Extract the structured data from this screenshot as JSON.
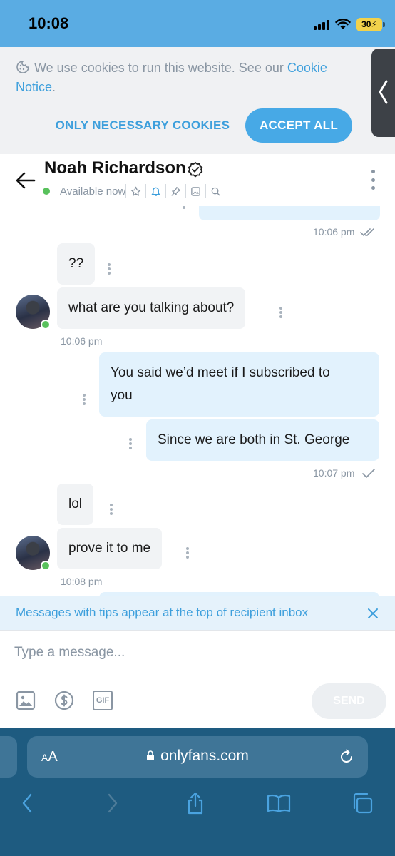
{
  "status_bar": {
    "time": "10:08",
    "battery": "30"
  },
  "cookie_banner": {
    "text": "We use cookies to run this website. See our ",
    "link": "Cookie Notice",
    "period": ".",
    "only_necessary": "ONLY NECESSARY COOKIES",
    "accept_all": "ACCEPT ALL"
  },
  "chat_header": {
    "name": "Noah Richardson",
    "status": "Available now"
  },
  "messages": {
    "first_time": "10:06 pm",
    "m1": "??",
    "m2": "what are you talking about?",
    "time2": "10:06 pm",
    "m3_line1": "You said we’d meet if I subscribed to",
    "m3_line2": "you",
    "m4": "Since we are both in St. George",
    "time3": "10:07 pm",
    "m5": "lol",
    "m6": "prove it to me",
    "time4": "10:08 pm"
  },
  "tips_notice": {
    "text": "Messages with tips appear at the top of recipient inbox"
  },
  "composer": {
    "placeholder": "Type a message...",
    "send": "SEND",
    "gif": "GIF"
  },
  "browser": {
    "aa_small": "A",
    "aa_large": "A",
    "url": "onlyfans.com"
  },
  "icons": {
    "cookie": "cookie-icon",
    "back": "back-arrow-icon",
    "verified": "verified-badge-icon",
    "star": "star-icon",
    "bell": "bell-icon",
    "pin": "pin-icon",
    "image": "image-icon",
    "search": "search-icon",
    "more": "more-vertical-icon",
    "check": "check-icon",
    "double_check": "double-check-icon",
    "close": "close-icon",
    "dollar": "dollar-icon",
    "gif": "gif-icon",
    "lock": "lock-icon",
    "reload": "reload-icon",
    "share": "share-icon",
    "bookmarks": "bookmarks-icon",
    "tabs": "tabs-icon"
  },
  "colors": {
    "accent": "#3d9fdc",
    "status_bar": "#5aace3",
    "safari": "#1e5b80",
    "outgoing_bubble": "#e2f2fd",
    "incoming_bubble": "#f1f3f5",
    "online": "#58c15c"
  }
}
